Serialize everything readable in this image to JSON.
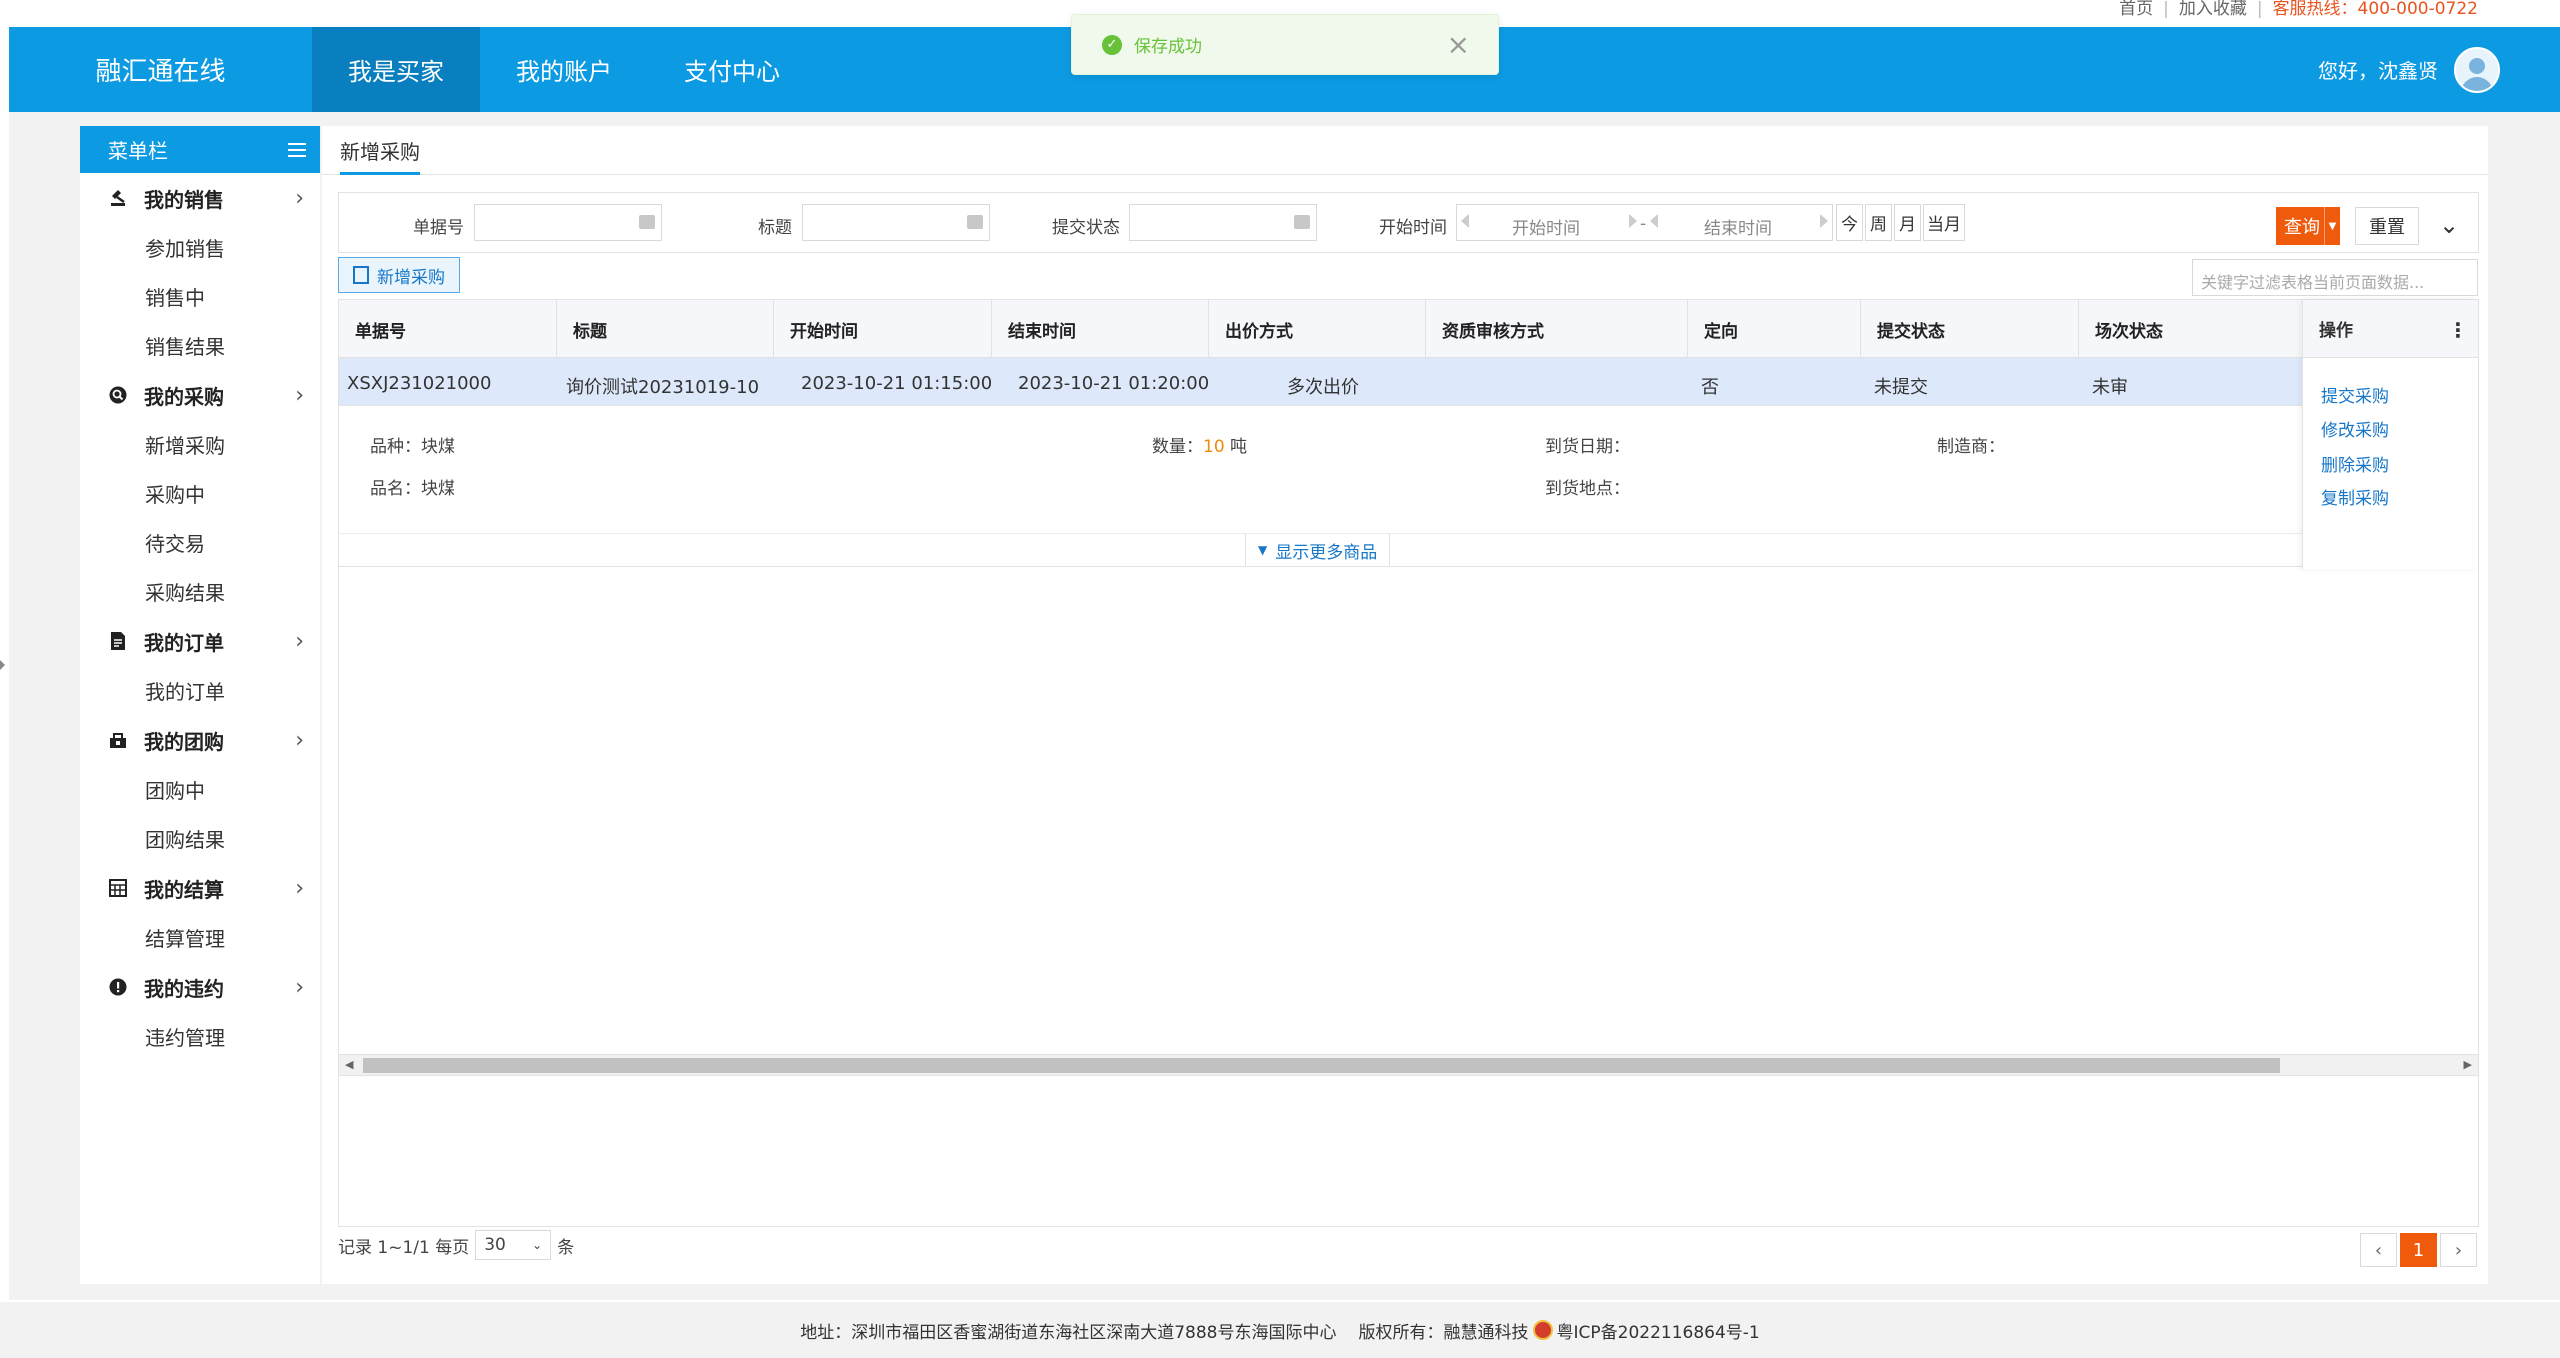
{
  "top_links": {
    "home": "首页",
    "favorite": "加入收藏",
    "hotline": "客服热线：400-000-0722"
  },
  "header": {
    "brand": "融汇通在线",
    "nav": [
      {
        "label": "我是买家",
        "active": true
      },
      {
        "label": "我的账户",
        "active": false
      },
      {
        "label": "支付中心",
        "active": false
      }
    ],
    "greeting": "您好，沈鑫贤"
  },
  "toast": {
    "message": "保存成功"
  },
  "sidebar": {
    "title": "菜单栏",
    "groups": [
      {
        "label": "我的销售",
        "icon": "auction-icon",
        "items": [
          "参加销售",
          "销售中",
          "销售结果"
        ]
      },
      {
        "label": "我的采购",
        "icon": "search-circle-icon",
        "items": [
          "新增采购",
          "采购中",
          "待交易",
          "采购结果"
        ]
      },
      {
        "label": "我的订单",
        "icon": "document-icon",
        "items": [
          "我的订单"
        ]
      },
      {
        "label": "我的团购",
        "icon": "group-icon",
        "items": [
          "团购中",
          "团购结果"
        ]
      },
      {
        "label": "我的结算",
        "icon": "calculator-icon",
        "items": [
          "结算管理"
        ]
      },
      {
        "label": "我的违约",
        "icon": "alert-icon",
        "items": [
          "违约管理"
        ]
      }
    ]
  },
  "tab": {
    "label": "新增采购"
  },
  "filter": {
    "order_no_label": "单据号",
    "title_label": "标题",
    "status_label": "提交状态",
    "time_label": "开始时间",
    "start_placeholder": "开始时间",
    "range_sep": "-",
    "end_placeholder": "结束时间",
    "quick": [
      "今",
      "周",
      "月",
      "当月"
    ],
    "search": "查询",
    "reset": "重置"
  },
  "toolbar": {
    "add": "新增采购",
    "keyword_placeholder": "关键字过滤表格当前页面数据..."
  },
  "table": {
    "columns": [
      "单据号",
      "标题",
      "开始时间",
      "结束时间",
      "出价方式",
      "资质审核方式",
      "定向",
      "提交状态",
      "场次状态"
    ],
    "ops_header": "操作",
    "row": {
      "order_no": "XSXJ231021000",
      "title": "询价测试20231019-10",
      "start": "2023-10-21 01:15:00",
      "end": "2023-10-21 01:20:00",
      "bid_mode": "多次出价",
      "review_mode": "",
      "directed": "否",
      "submit_status": "未提交",
      "session_status": "未审"
    },
    "detail": {
      "variety_label": "品种：",
      "variety": "块煤",
      "name_label": "品名：",
      "name": "块煤",
      "qty_label": "数量：",
      "qty": "10",
      "unit": " 吨",
      "arrival_date_label": "到货日期：",
      "arrival_place_label": "到货地点：",
      "maker_label": "制造商："
    },
    "more": "显示更多商品",
    "ops": [
      "提交采购",
      "修改采购",
      "删除采购",
      "复制采购"
    ]
  },
  "pager": {
    "records": "记录 1~1/1 每页",
    "page_size": "30",
    "unit": "条",
    "current": "1"
  },
  "footer": {
    "address": "地址：深圳市福田区香蜜湖街道东海社区深南大道7888号东海国际中心",
    "copyright": "版权所有：融慧通科技",
    "icp": "粤ICP备2022116864号-1"
  },
  "colors": {
    "brand_blue": "#0c9ae2",
    "accent_orange": "#ef5a0d",
    "link_blue": "#1677c9",
    "success_green": "#67c23a"
  }
}
